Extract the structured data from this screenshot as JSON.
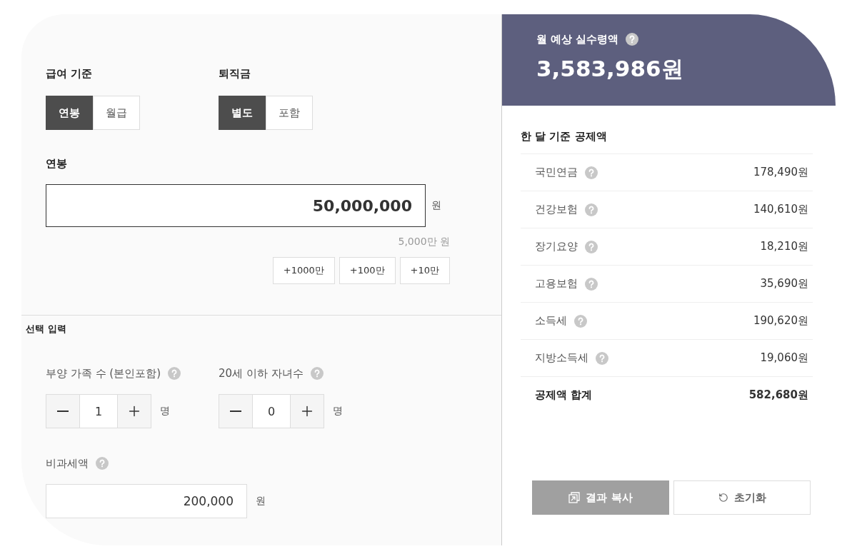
{
  "salary_basis": {
    "label": "급여 기준",
    "options": [
      {
        "label": "연봉",
        "selected": true
      },
      {
        "label": "월급",
        "selected": false
      }
    ]
  },
  "severance": {
    "label": "퇴직금",
    "options": [
      {
        "label": "별도",
        "selected": true
      },
      {
        "label": "포함",
        "selected": false
      }
    ]
  },
  "salary_input": {
    "label": "연봉",
    "value": "50,000,000",
    "unit": "원",
    "hint": "5,000만 원",
    "increments": [
      "+1000만",
      "+100만",
      "+10만"
    ]
  },
  "optional": {
    "title": "선택 입력",
    "counters": [
      {
        "label": "부양 가족 수 (본인포함)",
        "help": true,
        "value": "1",
        "unit": "명"
      },
      {
        "label": "20세 이하 자녀수",
        "help": true,
        "value": "0",
        "unit": "명"
      }
    ],
    "non_taxable": {
      "label": "비과세액",
      "help": true,
      "value": "200,000",
      "unit": "원"
    }
  },
  "result": {
    "title": "월 예상 실수령액",
    "help": true,
    "amount": "3,583,986원"
  },
  "deductions": {
    "title": "한 달 기준 공제액",
    "rows": [
      {
        "label": "국민연금",
        "help": true,
        "value": "178,490원"
      },
      {
        "label": "건강보험",
        "help": true,
        "value": "140,610원"
      },
      {
        "label": "장기요양",
        "help": true,
        "value": "18,210원"
      },
      {
        "label": "고용보험",
        "help": true,
        "value": "35,690원"
      },
      {
        "label": "소득세",
        "help": true,
        "value": "190,620원"
      },
      {
        "label": "지방소득세",
        "help": true,
        "value": "19,060원"
      }
    ],
    "total": {
      "label": "공제액 합계",
      "value": "582,680원"
    }
  },
  "actions": [
    {
      "label": "결과 복사",
      "kind": "copy"
    },
    {
      "label": "초기화",
      "kind": "reset"
    }
  ]
}
